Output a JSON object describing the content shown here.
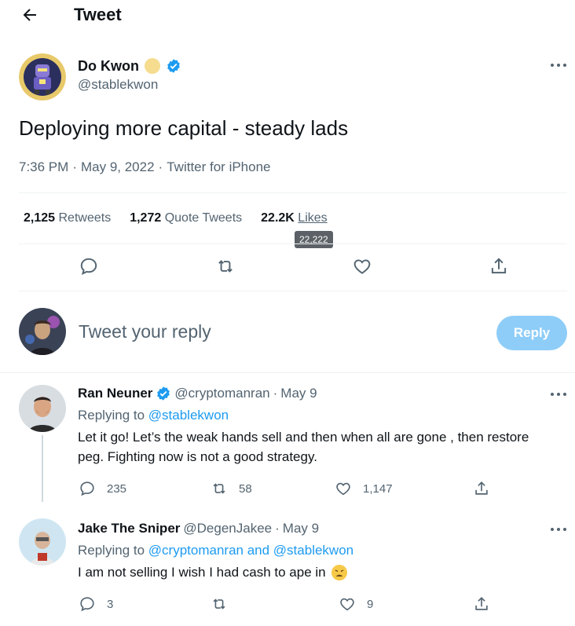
{
  "header": {
    "title": "Tweet"
  },
  "tweet": {
    "author_name": "Do Kwon",
    "author_handle": "@stablekwon",
    "text": "Deploying more capital - steady lads",
    "time": "7:36 PM",
    "sep1": "·",
    "date": "May 9, 2022",
    "sep2": "·",
    "source": "Twitter for iPhone",
    "retweets_count": "2,125",
    "retweets_label": "Retweets",
    "quotes_count": "1,272",
    "quotes_label": "Quote Tweets",
    "likes_count": "22.2K",
    "likes_label": "Likes",
    "likes_tooltip": "22,222"
  },
  "compose": {
    "placeholder": "Tweet your reply",
    "button_label": "Reply"
  },
  "replies": [
    {
      "name": "Ran Neuner",
      "handle": "@cryptomanran",
      "dot": "·",
      "date": "May 9",
      "replying_prefix": "Replying to",
      "replying_to": "@stablekwon",
      "text": "Let it go! Let’s the weak hands sell and then when all are gone , then restore peg. Fighting now is not a good strategy.",
      "replies": "235",
      "retweets": "58",
      "likes": "1,147"
    },
    {
      "name": "Jake The Sniper",
      "handle": "@DegenJakee",
      "dot": "·",
      "date": "May 9",
      "replying_prefix": "Replying to",
      "replying_to": "@cryptomanran and @stablekwon",
      "text": "I am not selling I wish I had cash to ape in",
      "replies": "3",
      "retweets": "",
      "likes": "9"
    }
  ],
  "icons": {
    "back": "arrow-left-icon",
    "more": "more-horizontal-icon",
    "verified": "verified-badge-icon",
    "reply": "reply-icon",
    "retweet": "retweet-icon",
    "like": "heart-icon",
    "share": "share-icon",
    "emoji": "weary-face-emoji"
  },
  "colors": {
    "accent": "#1d9bf0",
    "reply_button_disabled": "#8ecdf8",
    "secondary_text": "#536471"
  }
}
